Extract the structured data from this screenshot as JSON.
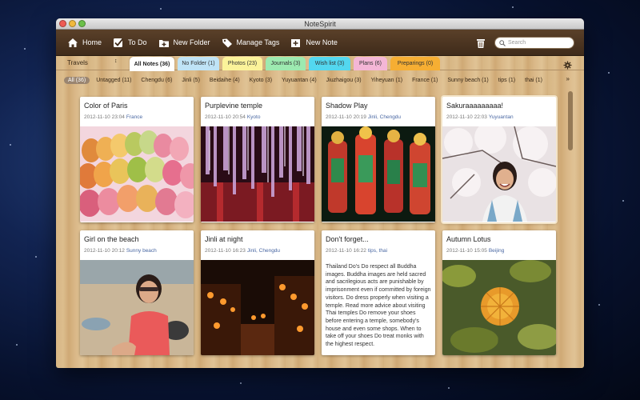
{
  "window": {
    "title": "NoteSpirit"
  },
  "toolbar": {
    "home": "Home",
    "todo": "To Do",
    "new_folder": "New Folder",
    "manage_tags": "Manage Tags",
    "new_note": "New Note",
    "search_placeholder": "Search"
  },
  "folder_selector": {
    "label": "Travels"
  },
  "tabs": [
    {
      "label": "All Notes (36)",
      "color": "#ffffff"
    },
    {
      "label": "No Folder (1)",
      "color": "#bfe3f6"
    },
    {
      "label": "Photos (23)",
      "color": "#fbf39a"
    },
    {
      "label": "Journals (3)",
      "color": "#9deab0"
    },
    {
      "label": "Wish list (3)",
      "color": "#53d7ef"
    },
    {
      "label": "Plans (6)",
      "color": "#f4b6d6"
    },
    {
      "label": "Preparings (0)",
      "color": "#f6ae33"
    }
  ],
  "tags": [
    "All (36)",
    "Untagged (11)",
    "Chengdu (6)",
    "Jinli (5)",
    "Beidaihe (4)",
    "Kyoto (3)",
    "Yuyuantan (4)",
    "Jiuzhaigou (3)",
    "Yiheyuan (1)",
    "France (1)",
    "Sunny beach (1)",
    "tips (1)",
    "thai (1)"
  ],
  "tags_more": "»",
  "notes": [
    {
      "title": "Color of Paris",
      "date": "2012-11-10 23:04",
      "location": "France",
      "image": "macarons-photo"
    },
    {
      "title": "Purplevine temple",
      "date": "2012-11-10 20:54",
      "location": "Kyoto",
      "image": "wisteria-temple-photo"
    },
    {
      "title": "Shadow Play",
      "date": "2012-11-10 20:19",
      "location": "Jinli, Chengdu",
      "image": "shadow-puppets-photo"
    },
    {
      "title": "Sakuraaaaaaaaa!",
      "date": "2012-11-10 22:03",
      "location": "Yuyuantan",
      "image": "cherry-blossom-photo"
    },
    {
      "title": "Girl on the beach",
      "date": "2012-11-10 20:12",
      "location": "Sunny beach",
      "image": "beach-girl-photo"
    },
    {
      "title": "Jinli at night",
      "date": "2012-11-10 16:23",
      "location": "Jinli, Chengdu",
      "image": "night-street-photo"
    },
    {
      "title": "Don't forget...",
      "date": "2012-11-10 16:22",
      "location": "tips, thai",
      "body": "Thailand Do's Do respect all Buddha images. Buddha images are held sacred and sacrilegious acts are punishable by imprisonment even if committed by foreign visitors. Do dress properly when visiting a temple. Read more advice about visiting Thai temples Do remove your shoes before entering a temple, somebody's house and even some shops. When to take off your shoes Do treat monks with the highest respect."
    },
    {
      "title": "Autumn Lotus",
      "date": "2012-11-10 15:05",
      "location": "Beijing",
      "image": "lotus-pond-photo"
    }
  ]
}
